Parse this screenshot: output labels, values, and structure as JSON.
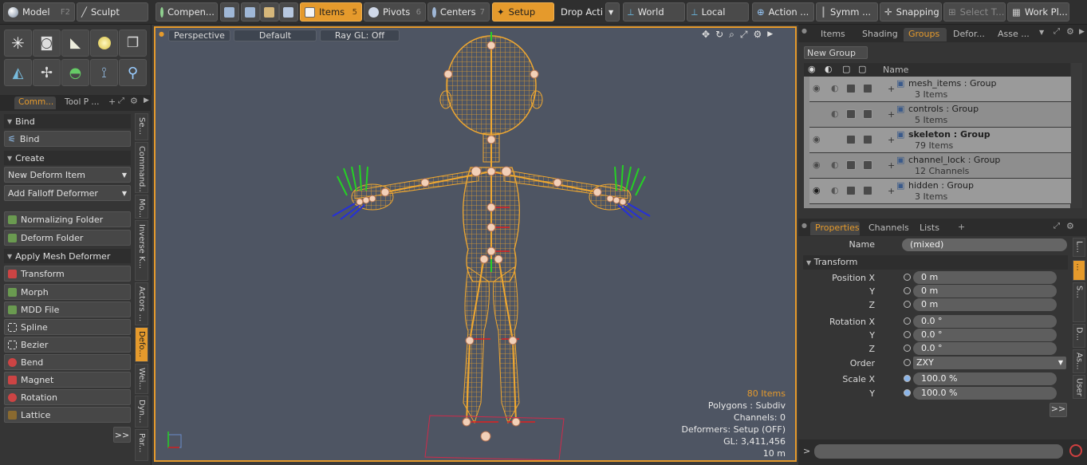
{
  "app": {
    "accent": "#e59a2c"
  },
  "toolbar": {
    "model": "Model",
    "model_key": "F2",
    "sculpt": "Sculpt",
    "components": "Compen...",
    "items": "Items",
    "items_key": "5",
    "pivots": "Pivots",
    "pivots_key": "6",
    "centers": "Centers",
    "centers_key": "7",
    "setup": "Setup",
    "drop_action": "Drop Action",
    "world": "World",
    "local": "Local",
    "action": "Action ...",
    "symmetry": "Symm ...",
    "snapping": "Snapping",
    "select_t": "Select T...",
    "work_plane": "Work Pl..."
  },
  "left": {
    "tabs": [
      "Comm...",
      "Tool P ..."
    ],
    "bind_section": "Bind",
    "bind_button": "Bind",
    "create_section": "Create",
    "new_deform_item": "New Deform Item",
    "add_falloff_deformer": "Add Falloff Deformer",
    "normalizing_folder": "Normalizing Folder",
    "deform_folder": "Deform Folder",
    "apply_mesh_deformer": "Apply Mesh Deformer",
    "deformers": [
      "Transform",
      "Morph",
      "MDD File",
      "Spline",
      "Bezier",
      "Bend",
      "Magnet",
      "Rotation",
      "Lattice"
    ],
    "more": ">>",
    "vtabs": [
      "Se...",
      "Command...",
      "Mo...",
      "Inverse K...",
      "Actors ...",
      "Defo...",
      "Wei...",
      "Dyn...",
      "Par..."
    ]
  },
  "viewport": {
    "view": "Perspective",
    "shading": "Default",
    "raygl": "Ray GL: Off",
    "stats": {
      "items": "80 Items",
      "polygons": "Polygons : Subdiv",
      "channels": "Channels: 0",
      "deformers": "Deformers: Setup (OFF)",
      "gl": "GL: 3,411,456",
      "scale": "10 m"
    }
  },
  "right_top": {
    "tabs": [
      "Items",
      "Shading",
      "Groups",
      "Defor...",
      "Asse ..."
    ],
    "new_group": "New Group",
    "col_name": "Name",
    "groups": [
      {
        "name": "mesh_items : Group",
        "count": "3 Items"
      },
      {
        "name": "controls : Group",
        "count": "5 Items"
      },
      {
        "name": "skeleton : Group",
        "count": "79 Items"
      },
      {
        "name": "channel_lock : Group",
        "count": "12 Channels"
      },
      {
        "name": "hidden : Group",
        "count": "3 Items"
      }
    ]
  },
  "properties": {
    "tabs": [
      "Properties",
      "Channels",
      "Lists"
    ],
    "name_label": "Name",
    "name_value": "(mixed)",
    "transform": "Transform",
    "position_x_label": "Position X",
    "position_x": "0 m",
    "position_y_label": "Y",
    "position_y": "0 m",
    "position_z_label": "Z",
    "position_z": "0 m",
    "rotation_x_label": "Rotation X",
    "rotation_x": "0.0 °",
    "rotation_y_label": "Y",
    "rotation_y": "0.0 °",
    "rotation_z_label": "Z",
    "rotation_z": "0.0 °",
    "order_label": "Order",
    "order_value": "ZXY",
    "scale_x_label": "Scale X",
    "scale_x": "100.0 %",
    "scale_y_label": "Y",
    "scale_y": "100.0 %",
    "more": ">>",
    "vtabs": [
      "L...",
      "...",
      "S...",
      "D...",
      "As...",
      "User ..."
    ]
  },
  "command": {
    "prompt": ">"
  }
}
